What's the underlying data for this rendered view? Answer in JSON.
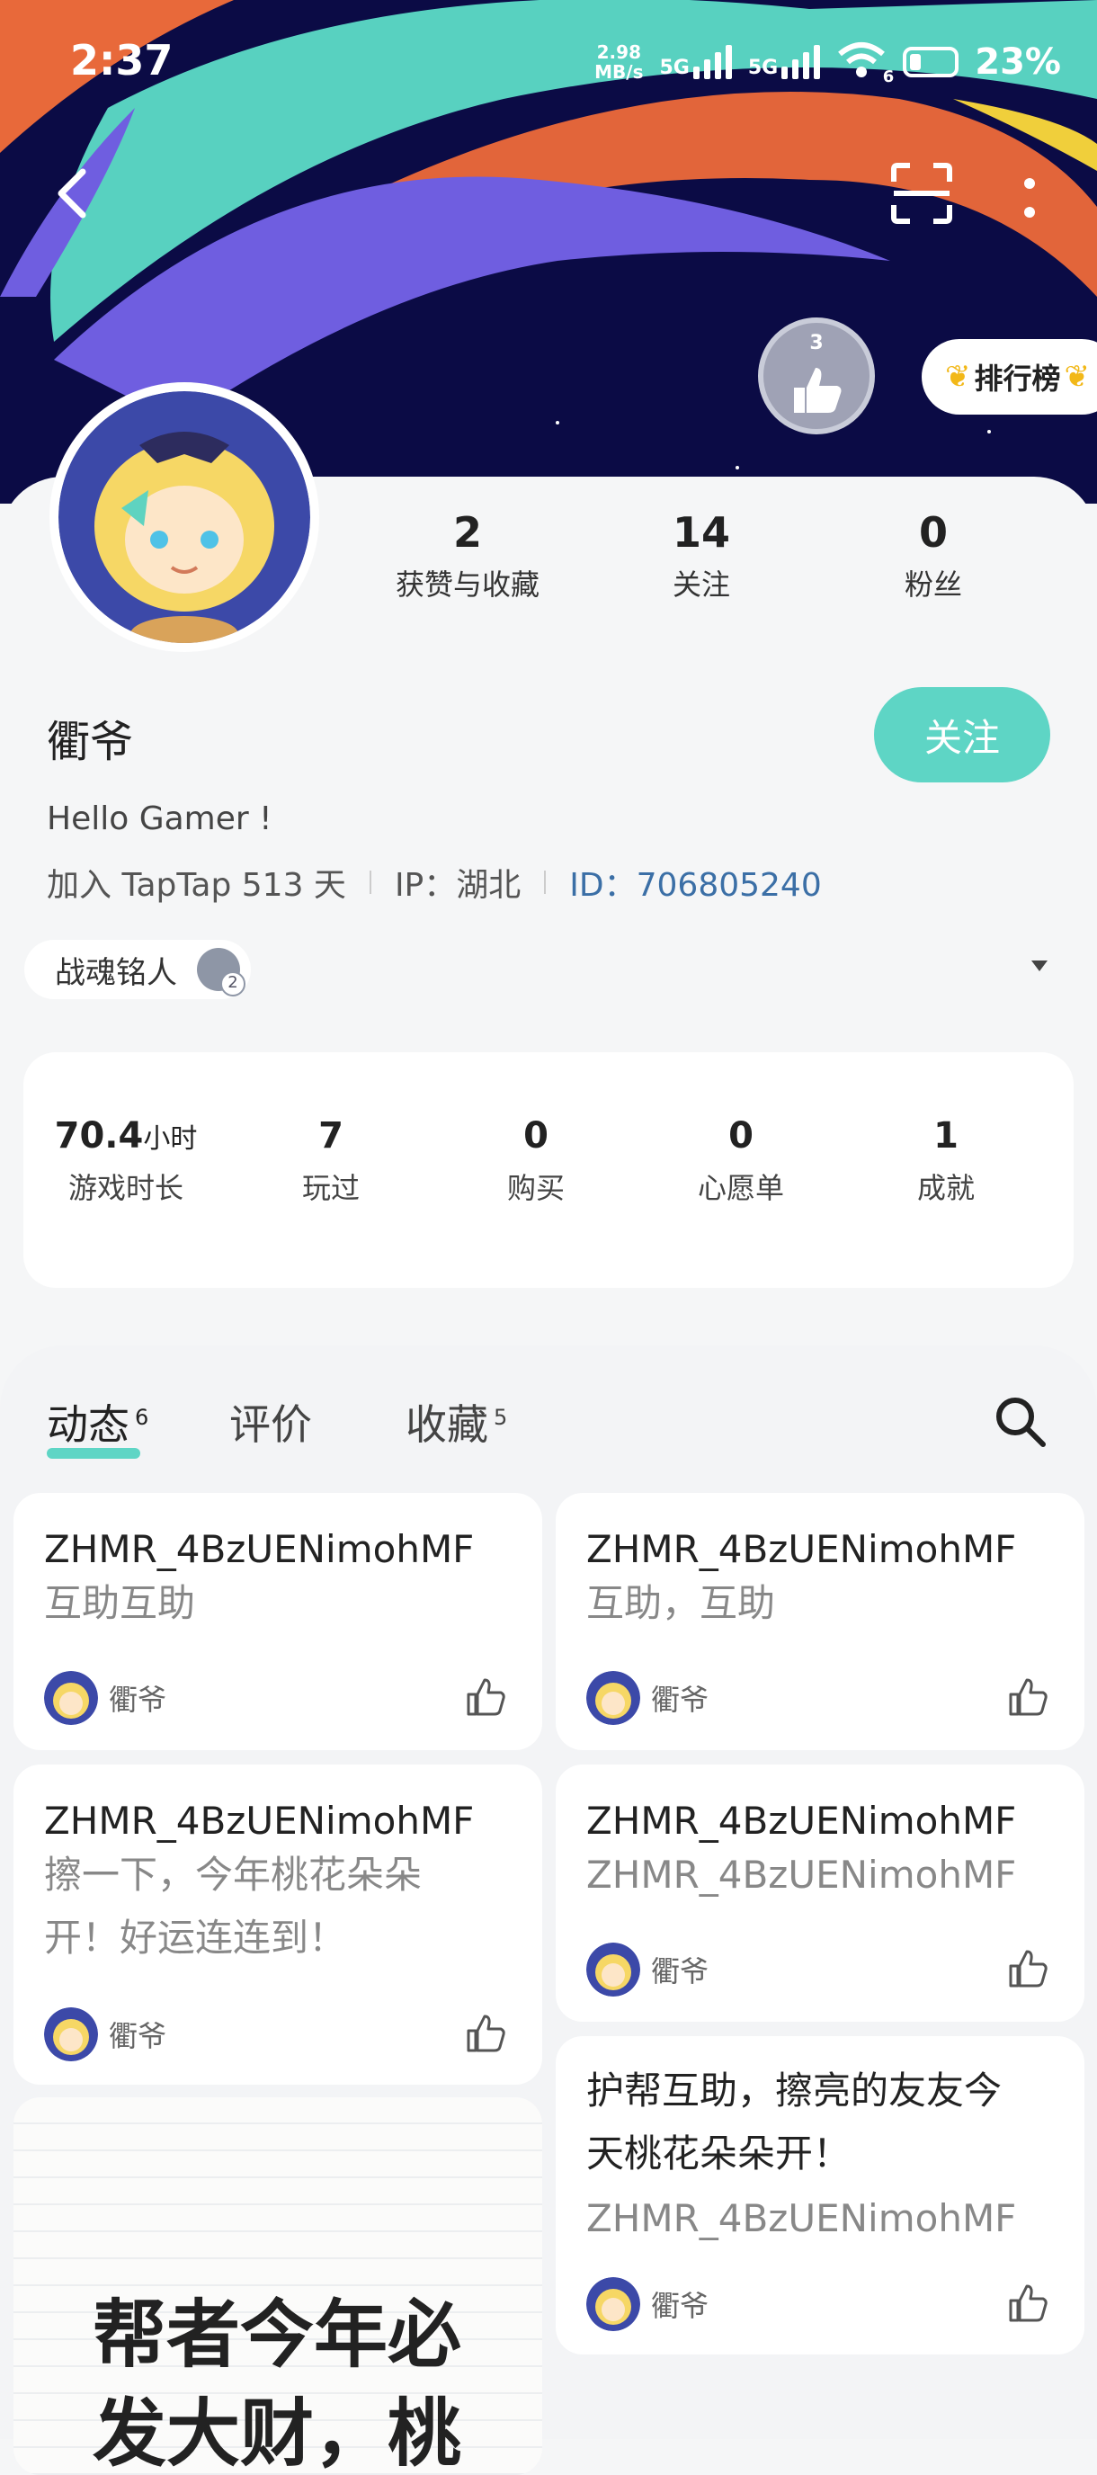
{
  "status_bar": {
    "time": "2:37",
    "net_speed_value": "2.98",
    "net_speed_unit": "MB/s",
    "sim1": "5G",
    "sim2": "5G",
    "wifi_badge": "6",
    "battery": "23%"
  },
  "header": {
    "medal_level": "3",
    "rank_label": "排行榜"
  },
  "profile": {
    "stats": [
      {
        "num": "2",
        "label": "获赞与收藏"
      },
      {
        "num": "14",
        "label": "关注"
      },
      {
        "num": "0",
        "label": "粉丝"
      }
    ],
    "name": "衢爷",
    "follow_label": "关注",
    "bio": "Hello Gamer !",
    "joined": "加入 TapTap 513 天",
    "ip": "IP：湖北",
    "id": "ID：706805240",
    "title_chip": "战魂铭人"
  },
  "game_stats": [
    {
      "num": "70.4",
      "unit": "小时",
      "label": "游戏时长"
    },
    {
      "num": "7",
      "label": "玩过"
    },
    {
      "num": "0",
      "label": "购买"
    },
    {
      "num": "0",
      "label": "心愿单"
    },
    {
      "num": "1",
      "label": "成就"
    }
  ],
  "tabs": [
    {
      "label": "动态",
      "count": "6"
    },
    {
      "label": "评价",
      "count": ""
    },
    {
      "label": "收藏",
      "count": "5"
    }
  ],
  "cards": {
    "c1": {
      "title": "ZHMR_4BzUENimohMF",
      "text": "互助互助",
      "author": "衢爷"
    },
    "c2": {
      "title": "ZHMR_4BzUENimohMF",
      "text": "互助，互助",
      "author": "衢爷"
    },
    "c3": {
      "title": "ZHMR_4BzUENimohMF",
      "text_line1": "擦一下，今年桃花朵朵",
      "text_line2": "开！好运连连到！",
      "author": "衢爷"
    },
    "c4": {
      "title": "ZHMR_4BzUENimohMF",
      "text": "ZHMR_4BzUENimohMF",
      "author": "衢爷"
    },
    "c5": {
      "text_line1": "护帮互助，擦亮的友友今",
      "text_line2": "天桃花朵朵开！",
      "sub": "ZHMR_4BzUENimohMF",
      "author": "衢爷"
    }
  },
  "promo": {
    "line1": "帮者今年必",
    "line2": "发大财，桃"
  },
  "colors": {
    "accent": "#5ed5c5",
    "banner_bg": "#0b0b45",
    "id_link": "#3b6fa6"
  }
}
